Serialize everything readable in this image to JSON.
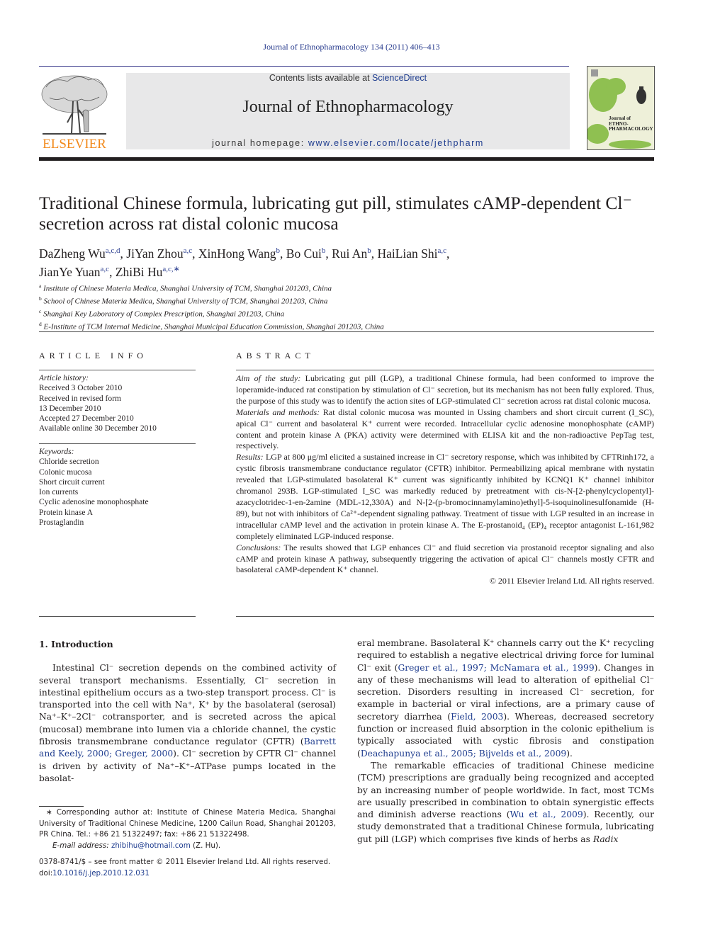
{
  "running_head": "Journal of Ethnopharmacology 134 (2011) 406–413",
  "header": {
    "publisher": "ELSEVIER",
    "contents_prefix": "Contents lists available at ",
    "contents_link": "ScienceDirect",
    "journal_name": "Journal of Ethnopharmacology",
    "homepage_prefix": "journal homepage: ",
    "homepage_link": "www.elsevier.com/locate/jethpharm",
    "cover_lines": [
      "Journal of",
      "ETHNO-",
      "PHARMACOLOGY"
    ],
    "colors": {
      "publisher_orange": "#f28a1c",
      "link_blue": "#1f3d8f",
      "banner_gray": "#e8e8e9"
    }
  },
  "article": {
    "title": "Traditional Chinese formula, lubricating gut pill, stimulates cAMP-dependent Cl⁻ secretion across rat distal colonic mucosa",
    "authors": [
      {
        "name": "DaZheng Wu",
        "sup": "a,c,d"
      },
      {
        "name": "JiYan Zhou",
        "sup": "a,c"
      },
      {
        "name": "XinHong Wang",
        "sup": "b"
      },
      {
        "name": "Bo Cui",
        "sup": "b"
      },
      {
        "name": "Rui An",
        "sup": "b"
      },
      {
        "name": "HaiLian Shi",
        "sup": "a,c"
      },
      {
        "name": "JianYe Yuan",
        "sup": "a,c"
      },
      {
        "name": "ZhiBi Hu",
        "sup": "a,c,∗"
      }
    ],
    "affiliations": [
      {
        "mark": "a",
        "text": "Institute of Chinese Materia Medica, Shanghai University of TCM, Shanghai 201203, China"
      },
      {
        "mark": "b",
        "text": "School of Chinese Materia Medica, Shanghai University of TCM, Shanghai 201203, China"
      },
      {
        "mark": "c",
        "text": "Shanghai Key Laboratory of Complex Prescription, Shanghai 201203, China"
      },
      {
        "mark": "d",
        "text": "E-Institute of TCM Internal Medicine, Shanghai Municipal Education Commission, Shanghai 201203, China"
      }
    ]
  },
  "article_info": {
    "label": "ARTICLE INFO",
    "history_heading": "Article history:",
    "history": [
      "Received 3 October 2010",
      "Received in revised form",
      "13 December 2010",
      "Accepted 27 December 2010",
      "Available online 30 December 2010"
    ],
    "keywords_heading": "Keywords:",
    "keywords": [
      "Chloride secretion",
      "Colonic mucosa",
      "Short circuit current",
      "Ion currents",
      "Cyclic adenosine monophosphate",
      "Protein kinase A",
      "Prostaglandin"
    ]
  },
  "abstract": {
    "label": "ABSTRACT",
    "sections": [
      {
        "lead": "Aim of the study:",
        "text": " Lubricating gut pill (LGP), a traditional Chinese formula, had been conformed to improve the loperamide-induced rat constipation by stimulation of Cl⁻ secretion, but its mechanism has not been fully explored. Thus, the purpose of this study was to identify the action sites of LGP-stimulated Cl⁻ secretion across rat distal colonic mucosa."
      },
      {
        "lead": "Materials and methods:",
        "text": " Rat distal colonic mucosa was mounted in Ussing chambers and short circuit current (I_SC), apical Cl⁻ current and basolateral K⁺ current were recorded. Intracellular cyclic adenosine monophosphate (cAMP) content and protein kinase A (PKA) activity were determined with ELISA kit and the non-radioactive PepTag test, respectively."
      },
      {
        "lead": "Results:",
        "text": " LGP at 800 μg/ml elicited a sustained increase in Cl⁻ secretory response, which was inhibited by CFTRinh172, a cystic fibrosis transmembrane conductance regulator (CFTR) inhibitor. Permeabilizing apical membrane with nystatin revealed that LGP-stimulated basolateral K⁺ current was significantly inhibited by KCNQ1 K⁺ channel inhibitor chromanol 293B. LGP-stimulated I_SC was markedly reduced by pretreatment with cis-N-[2-phenylcyclopentyl]-azacyclotridec-1-en-2amine (MDL-12,330A) and N-[2-(p-bromocinnamylamino)ethyl]-5-isoquinolinesulfonamide (H-89), but not with inhibitors of Ca²⁺-dependent signaling pathway. Treatment of tissue with LGP resulted in an increase in intracellular cAMP level and the activation in protein kinase A. The E-prostanoid₄ (EP)₄ receptor antagonist L-161,982 completely eliminated LGP-induced response."
      },
      {
        "lead": "Conclusions:",
        "text": " The results showed that LGP enhances Cl⁻ and fluid secretion via prostanoid receptor signaling and also cAMP and protein kinase A pathway, subsequently triggering the activation of apical Cl⁻ channels mostly CFTR and basolateral cAMP-dependent K⁺ channel."
      }
    ],
    "copyright": "© 2011 Elsevier Ireland Ltd. All rights reserved."
  },
  "body": {
    "intro_heading": "1.  Introduction",
    "left_para": {
      "before": "Intestinal Cl⁻ secretion depends on the combined activity of several transport mechanisms. Essentially, Cl⁻ secretion in intestinal epithelium occurs as a two-step transport process. Cl⁻ is transported into the cell with Na⁺, K⁺ by the basolateral (serosal) Na⁺–K⁺–2Cl⁻ cotransporter, and is secreted across the apical (mucosal) membrane into lumen via a chloride channel, the cystic fibrosis transmembrane conductance regulator (CFTR) (",
      "cite": "Barrett and Keely, 2000; Greger, 2000",
      "after": "). Cl⁻ secretion by CFTR Cl⁻ channel is driven by activity of Na⁺–K⁺–ATPase pumps located in the basolat-"
    },
    "right_para1": {
      "t1": "eral membrane. Basolateral K⁺ channels carry out the K⁺ recycling required to establish a negative electrical driving force for luminal Cl⁻ exit (",
      "c1": "Greger et al., 1997; McNamara et al., 1999",
      "t2": "). Changes in any of these mechanisms will lead to alteration of epithelial Cl⁻ secretion. Disorders resulting in increased Cl⁻ secretion, for example in bacterial or viral infections, are a primary cause of secretory diarrhea (",
      "c2": "Field, 2003",
      "t3": "). Whereas, decreased secretory function or increased fluid absorption in the colonic epithelium is typically associated with cystic fibrosis and constipation (",
      "c3": "Deachapunya et al., 2005; Bijvelds et al., 2009",
      "t4": ")."
    },
    "right_para2": {
      "t1": "The remarkable efficacies of traditional Chinese medicine (TCM) prescriptions are gradually being recognized and accepted by an increasing number of people worldwide. In fact, most TCMs are usually prescribed in combination to obtain synergistic effects and diminish adverse reactions (",
      "c1": "Wu et al., 2009",
      "t2": "). Recently, our study demonstrated that a traditional Chinese formula, lubricating gut pill (LGP) which comprises five kinds of herbs as ",
      "italic": "Radix"
    }
  },
  "footnote": {
    "corresponding": "∗ Corresponding author at: Institute of Chinese Materia Medica, Shanghai University of Traditional Chinese Medicine, 1200 Cailun Road, Shanghai 201203, PR China. Tel.: +86 21 51322497; fax: +86 21 51322498.",
    "email_label": "E-mail address:",
    "email": "zhibihu@hotmail.com",
    "email_suffix": " (Z. Hu).",
    "front_matter": "0378-8741/$ – see front matter © 2011 Elsevier Ireland Ltd. All rights reserved.",
    "doi_label": "doi:",
    "doi": "10.1016/j.jep.2010.12.031"
  }
}
